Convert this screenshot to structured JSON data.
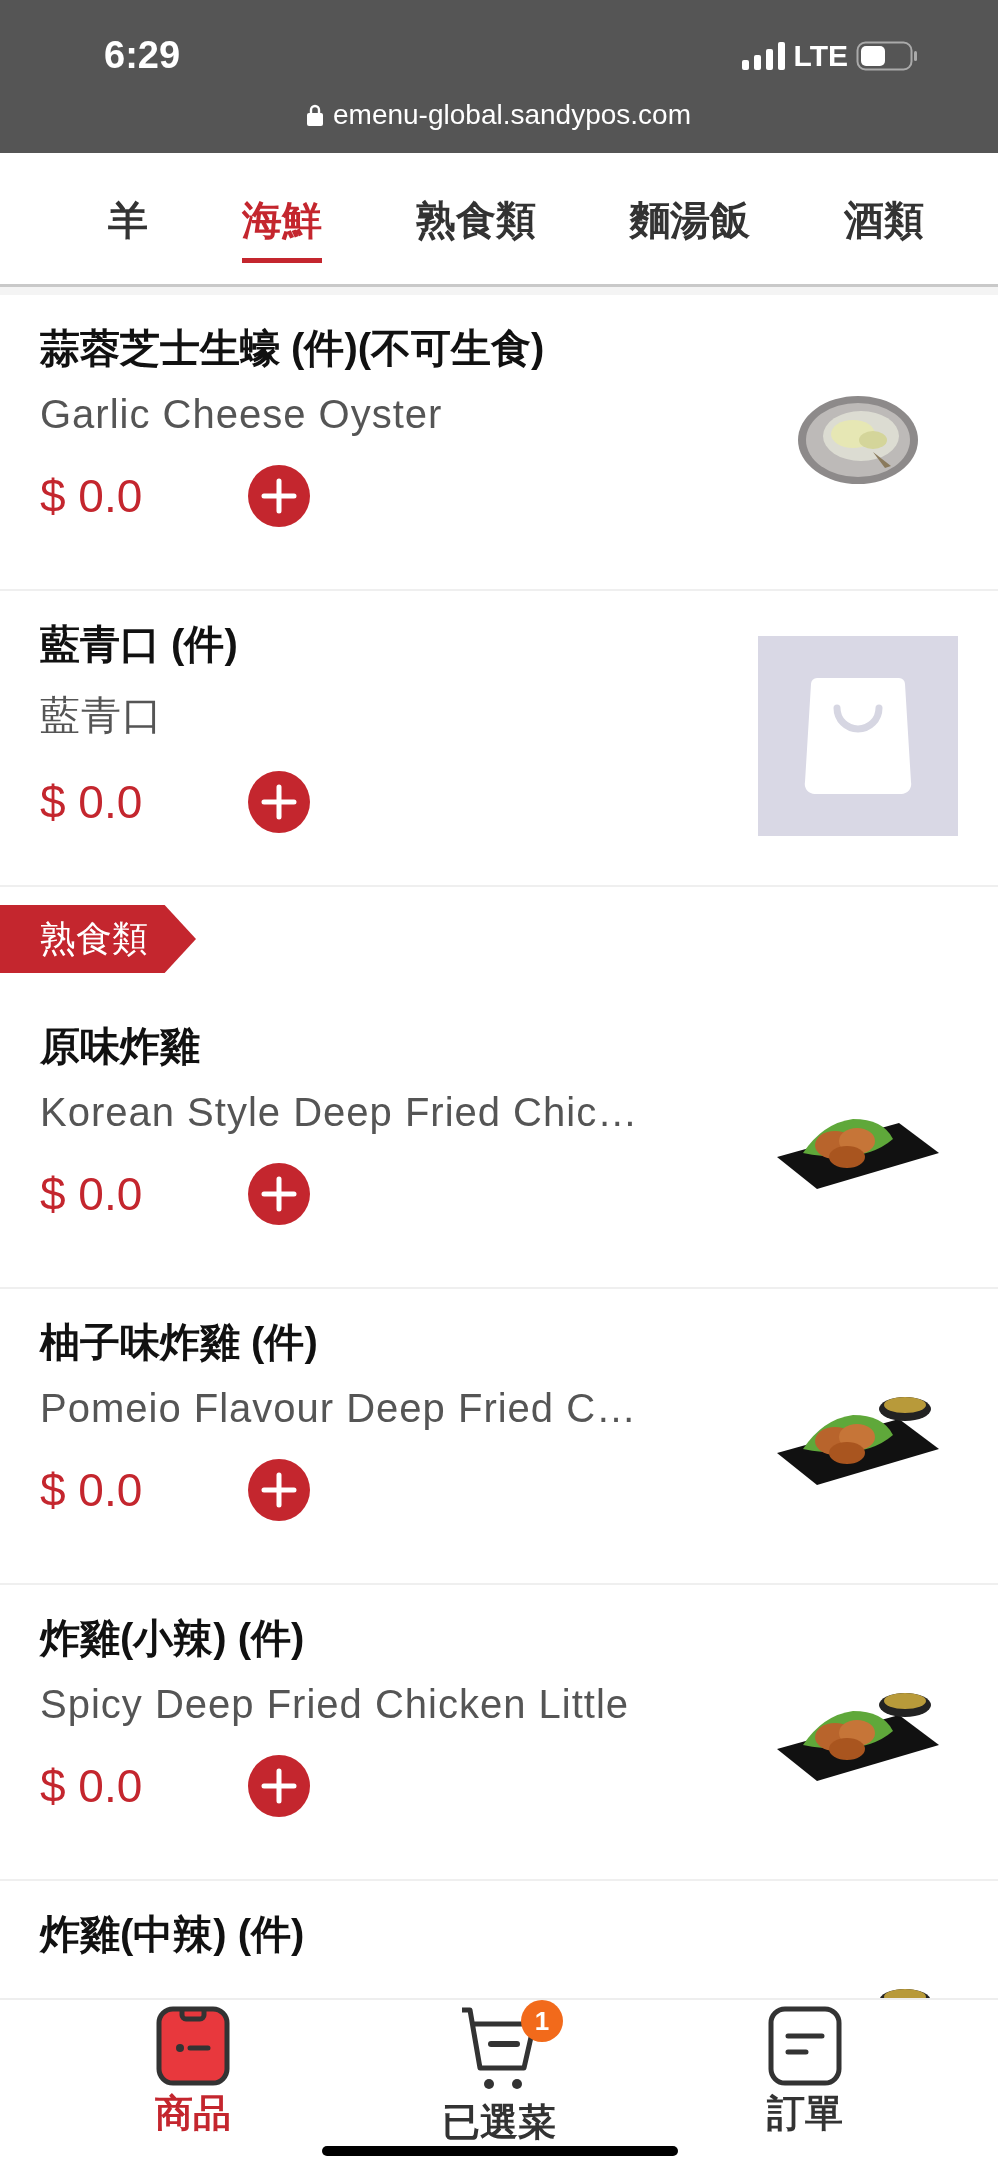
{
  "status_bar": {
    "time": "6:29",
    "network": "LTE",
    "url": "emenu-global.sandypos.com"
  },
  "category_tabs": [
    {
      "label": "羊",
      "selected": false
    },
    {
      "label": "海鮮",
      "selected": true
    },
    {
      "label": "熟食類",
      "selected": false
    },
    {
      "label": "麵湯飯",
      "selected": false
    },
    {
      "label": "酒類",
      "selected": false
    }
  ],
  "menu": [
    {
      "kind": "item",
      "name": "蒜蓉芝士生蠔 (件)(不可生食)",
      "subtitle": "Garlic Cheese Oyster",
      "price": "$ 0.0"
    },
    {
      "kind": "item",
      "name": "藍青口 (件)",
      "subtitle": "藍青口",
      "price": "$ 0.0"
    },
    {
      "kind": "section",
      "label": "熟食類"
    },
    {
      "kind": "item",
      "name": "原味炸雞",
      "subtitle": "Korean Style Deep Fried Chic…",
      "price": "$ 0.0"
    },
    {
      "kind": "item",
      "name": "柚子味炸雞 (件)",
      "subtitle": "Pomeio Flavour Deep Fried C…",
      "price": "$ 0.0"
    },
    {
      "kind": "item",
      "name": "炸雞(小辣) (件)",
      "subtitle": "Spicy Deep Fried Chicken Little",
      "price": "$ 0.0"
    },
    {
      "kind": "item",
      "name": "炸雞(中辣) (件)"
    }
  ],
  "bottom_nav": [
    {
      "kind": "products",
      "label": "商品",
      "selected": true
    },
    {
      "kind": "cart",
      "label": "已選菜",
      "badge": "1",
      "selected": false
    },
    {
      "kind": "orders",
      "label": "訂單",
      "selected": false
    }
  ]
}
